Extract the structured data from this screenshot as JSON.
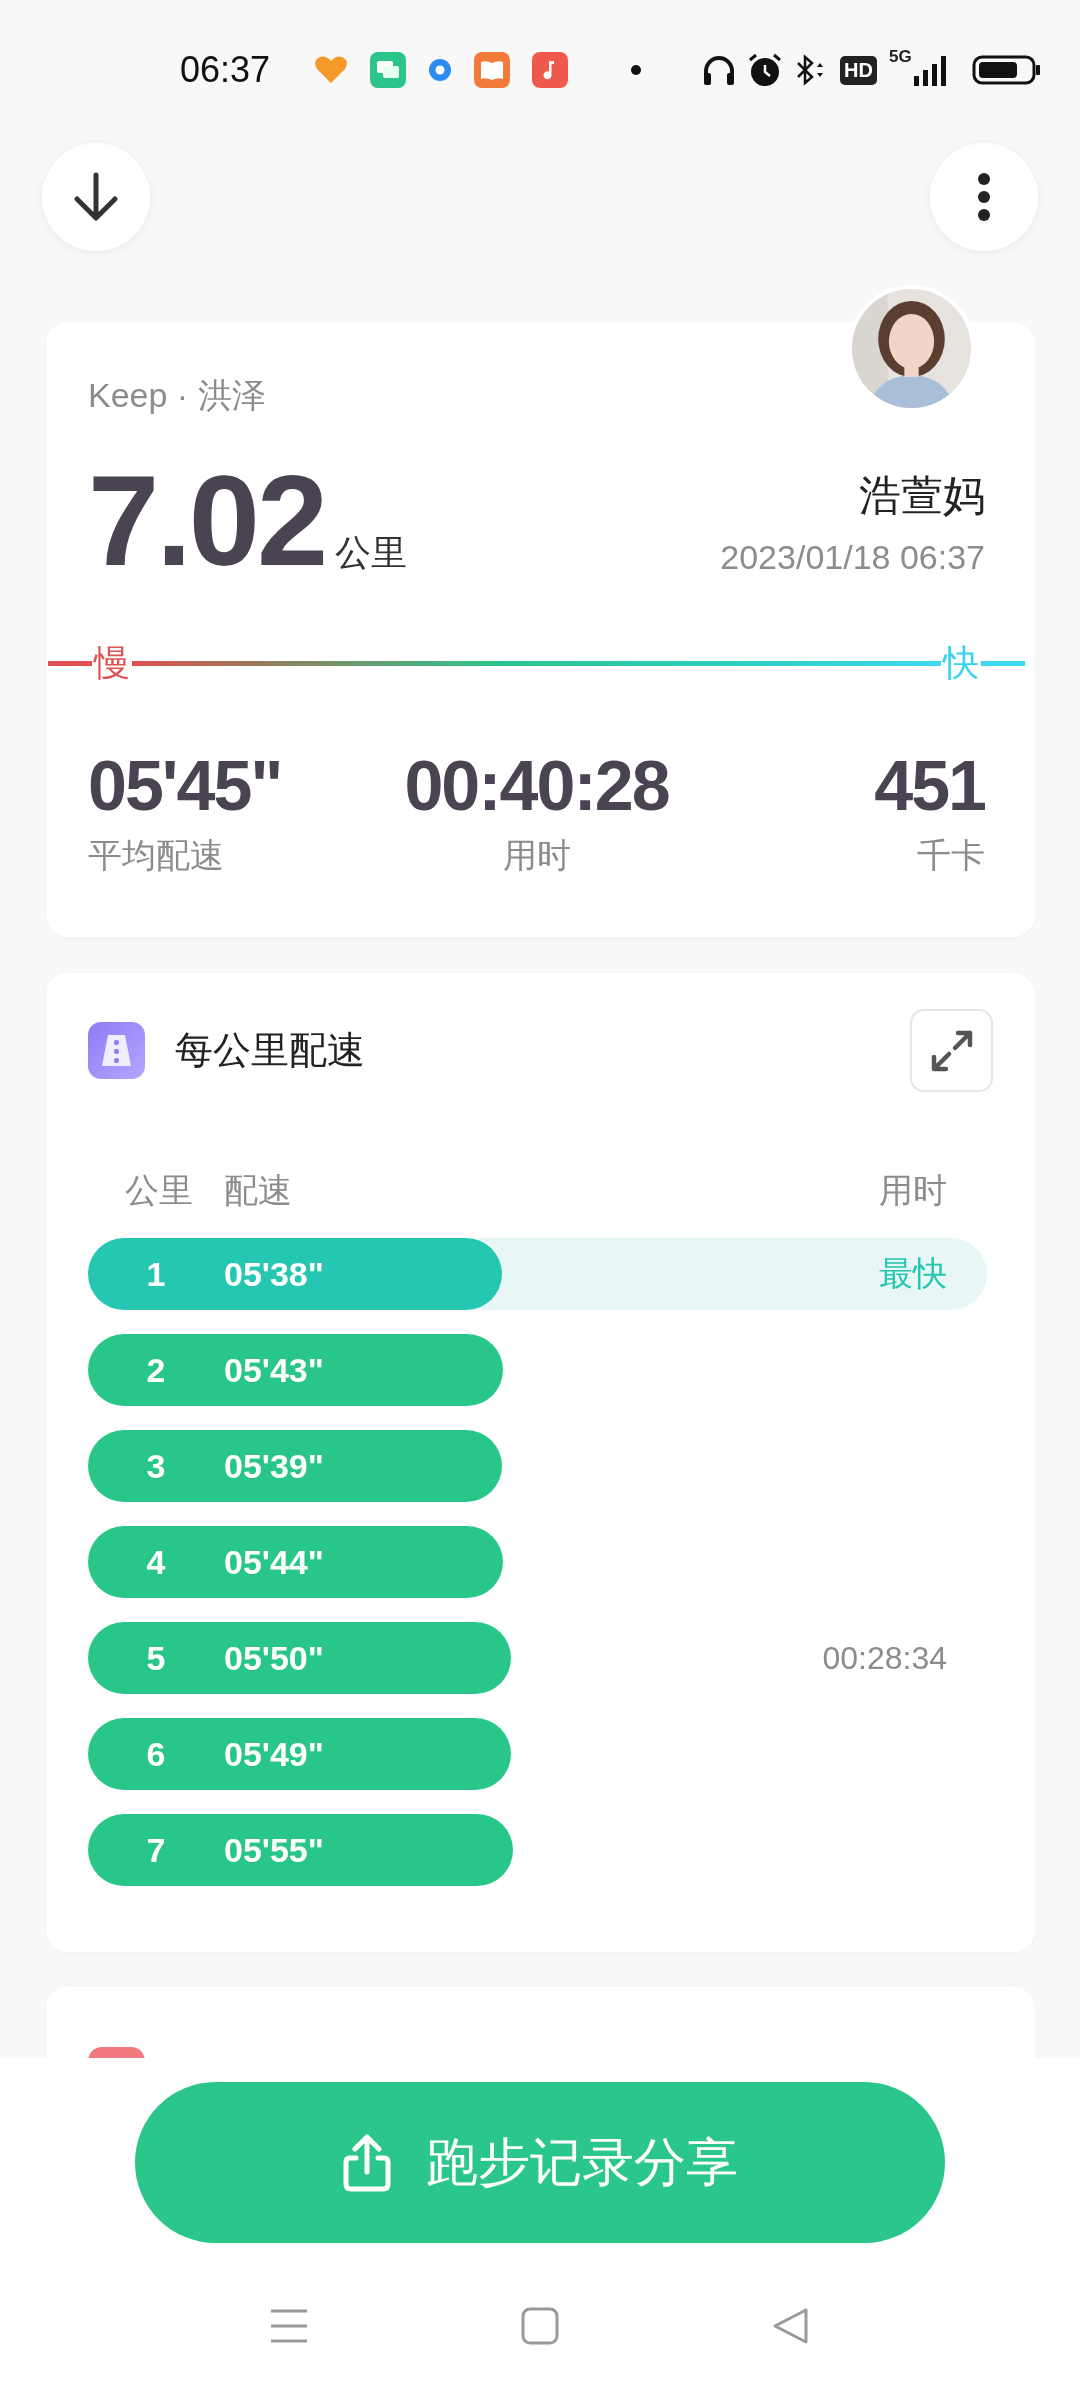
{
  "status_bar": {
    "time": "06:37",
    "hd_label": "HD",
    "network_label": "5G"
  },
  "summary": {
    "source": "Keep · 洪泽",
    "distance": "7.02",
    "distance_unit": "公里",
    "user_name": "浩萱妈",
    "datetime": "2023/01/18 06:37",
    "slow_label": "慢",
    "fast_label": "快",
    "stats": [
      {
        "value": "05'45\"",
        "label": "平均配速"
      },
      {
        "value": "00:40:28",
        "label": "用时"
      },
      {
        "value": "451",
        "label": "千卡"
      }
    ]
  },
  "pace_card": {
    "title": "每公里配速",
    "columns": [
      "公里",
      "配速",
      "用时"
    ],
    "rows": [
      {
        "km": "1",
        "pace": "05'38\"",
        "level": 0.46,
        "highlighted": true,
        "tag": "最快"
      },
      {
        "km": "2",
        "pace": "05'43\"",
        "level": 0.462,
        "highlighted": false
      },
      {
        "km": "3",
        "pace": "05'39\"",
        "level": 0.46,
        "highlighted": false
      },
      {
        "km": "4",
        "pace": "05'44\"",
        "level": 0.462,
        "highlighted": false
      },
      {
        "km": "5",
        "pace": "05'50\"",
        "level": 0.47,
        "highlighted": false,
        "time": "00:28:34"
      },
      {
        "km": "6",
        "pace": "05'49\"",
        "level": 0.47,
        "highlighted": false
      },
      {
        "km": "7",
        "pace": "05'55\"",
        "level": 0.473,
        "highlighted": false
      }
    ]
  },
  "share_button": {
    "label": "跑步记录分享"
  }
}
